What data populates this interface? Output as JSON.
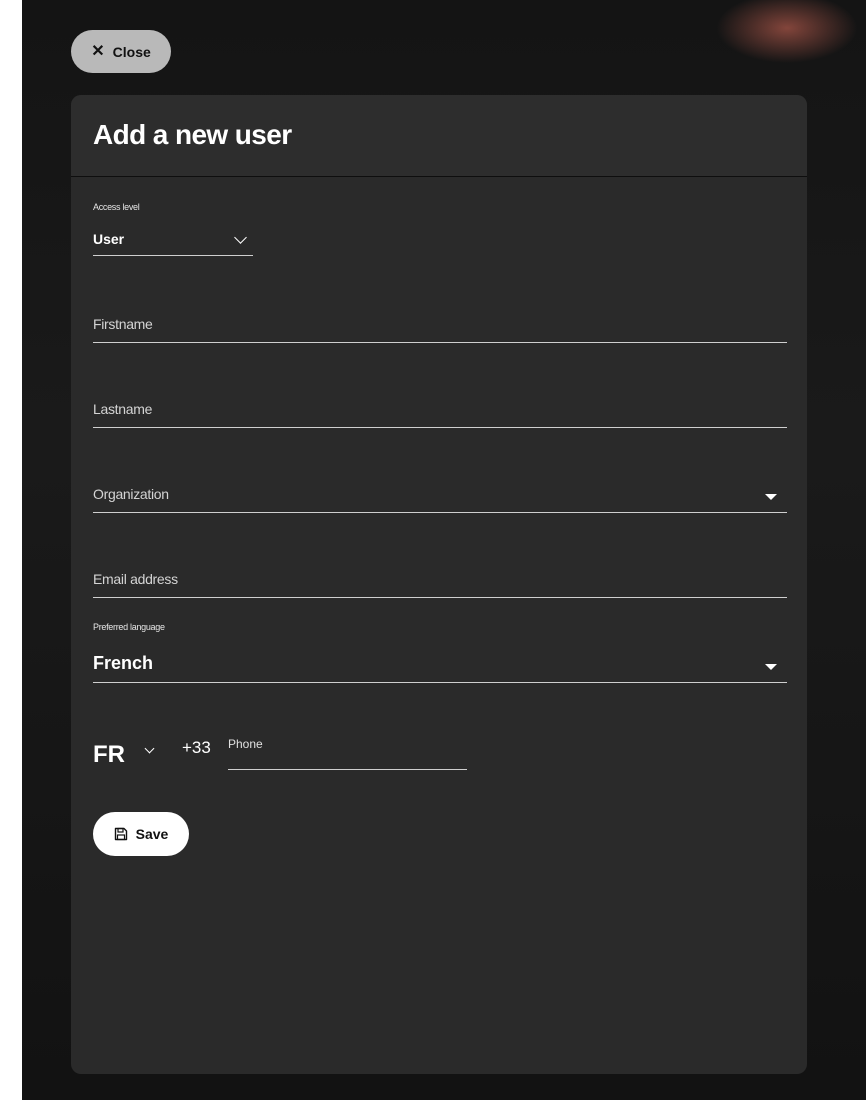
{
  "close_button": {
    "label": "Close",
    "icon": "close-icon"
  },
  "form": {
    "title": "Add a new user",
    "access_level": {
      "label": "Access level",
      "value": "User"
    },
    "firstname": {
      "placeholder": "Firstname",
      "value": ""
    },
    "lastname": {
      "placeholder": "Lastname",
      "value": ""
    },
    "organization": {
      "placeholder": "Organization",
      "value": ""
    },
    "email": {
      "placeholder": "Email address",
      "value": ""
    },
    "preferred_language": {
      "label": "Preferred language",
      "value": "French"
    },
    "phone": {
      "country_code": "FR",
      "dial_code": "+33",
      "placeholder": "Phone",
      "value": ""
    },
    "save_button": {
      "label": "Save",
      "icon": "save-icon"
    }
  },
  "colors": {
    "backdrop": "#141414",
    "panel": "#2a2a2a",
    "close_button_bg": "#b9b9b9",
    "save_button_bg": "#ffffff",
    "text": "#ffffff"
  }
}
